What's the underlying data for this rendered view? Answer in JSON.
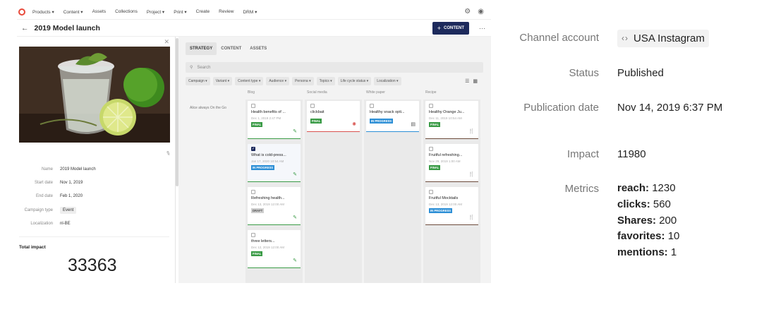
{
  "nav": {
    "items": [
      "Products ▾",
      "Content ▾",
      "Assets",
      "Collections",
      "Project ▾",
      "Print ▾",
      "Create",
      "Review",
      "DRM ▾"
    ]
  },
  "header": {
    "title": "2019 Model launch",
    "content_button": "CONTENT"
  },
  "campaign": {
    "fields": [
      {
        "label": "Name",
        "value": "2019 Model launch"
      },
      {
        "label": "Start date",
        "value": "Nov 1, 2019"
      },
      {
        "label": "End date",
        "value": "Feb 1, 2020"
      },
      {
        "label": "Campaign type",
        "value": "Event"
      },
      {
        "label": "Localization",
        "value": "nl-BE"
      }
    ],
    "total_impact_label": "Total impact",
    "total_impact_value": "33363"
  },
  "tabs": [
    "STRATEGY",
    "CONTENT",
    "ASSETS"
  ],
  "search": {
    "placeholder": "Search"
  },
  "filters": [
    "Campaign ▾",
    "Variant ▾",
    "Content type ▾",
    "Audience ▾",
    "Persona ▾",
    "Topics ▾",
    "Life cycle status ▾",
    "Localization ▾"
  ],
  "board": {
    "columns": [
      "Blog",
      "Social media",
      "White paper",
      "Recipe"
    ],
    "row_label": "Alice always On the Go",
    "cards": [
      {
        "col": 0,
        "title": "Health benefits of ...",
        "date": "Dec 1, 2019 2:47 PM",
        "status": "FINAL"
      },
      {
        "col": 0,
        "title": "What is cold-press...",
        "date": "Jan 17, 2020 10:54 AM",
        "status": "IN PROGRESS"
      },
      {
        "col": 0,
        "title": "Refreshing health...",
        "date": "Dec 13, 2019 12:00 AM",
        "status": "DRAFT"
      },
      {
        "col": 0,
        "title": "three letters...",
        "date": "Dec 12, 2019 12:00 AM",
        "status": "FINAL"
      },
      {
        "col": 1,
        "title": "clickbait",
        "date": "",
        "status": "FINAL"
      },
      {
        "col": 2,
        "title": "Healthy snack opti...",
        "date": "",
        "status": "IN PROGRESS"
      },
      {
        "col": 3,
        "title": "Healthy Orange Ju...",
        "date": "Dec 11, 2019 10:54 AM",
        "status": "FINAL"
      },
      {
        "col": 3,
        "title": "Fruitful refreshing...",
        "date": "Nov 29, 2019 1:00 AM",
        "status": "FINAL"
      },
      {
        "col": 3,
        "title": "Fruitful Mocktails",
        "date": "Dec 13, 2019 12:00 AM",
        "status": "IN PROGRESS"
      }
    ]
  },
  "detail": {
    "channel_account_label": "Channel account",
    "channel_account_value": "USA Instagram",
    "status_label": "Status",
    "status_value": "Published",
    "publication_date_label": "Publication date",
    "publication_date_value": "Nov 14, 2019 6:37 PM",
    "impact_label": "Impact",
    "impact_value": "11980",
    "metrics_label": "Metrics",
    "metrics": [
      {
        "name": "reach:",
        "value": "1230"
      },
      {
        "name": "clicks:",
        "value": "560"
      },
      {
        "name": "Shares:",
        "value": "200"
      },
      {
        "name": "favorites:",
        "value": "10"
      },
      {
        "name": "mentions:",
        "value": "1"
      }
    ]
  },
  "colors": {
    "brand_navy": "#1d2a5c",
    "final_green": "#3a9b46",
    "progress_blue": "#2d8fd6",
    "logo_red": "#e8493a"
  }
}
